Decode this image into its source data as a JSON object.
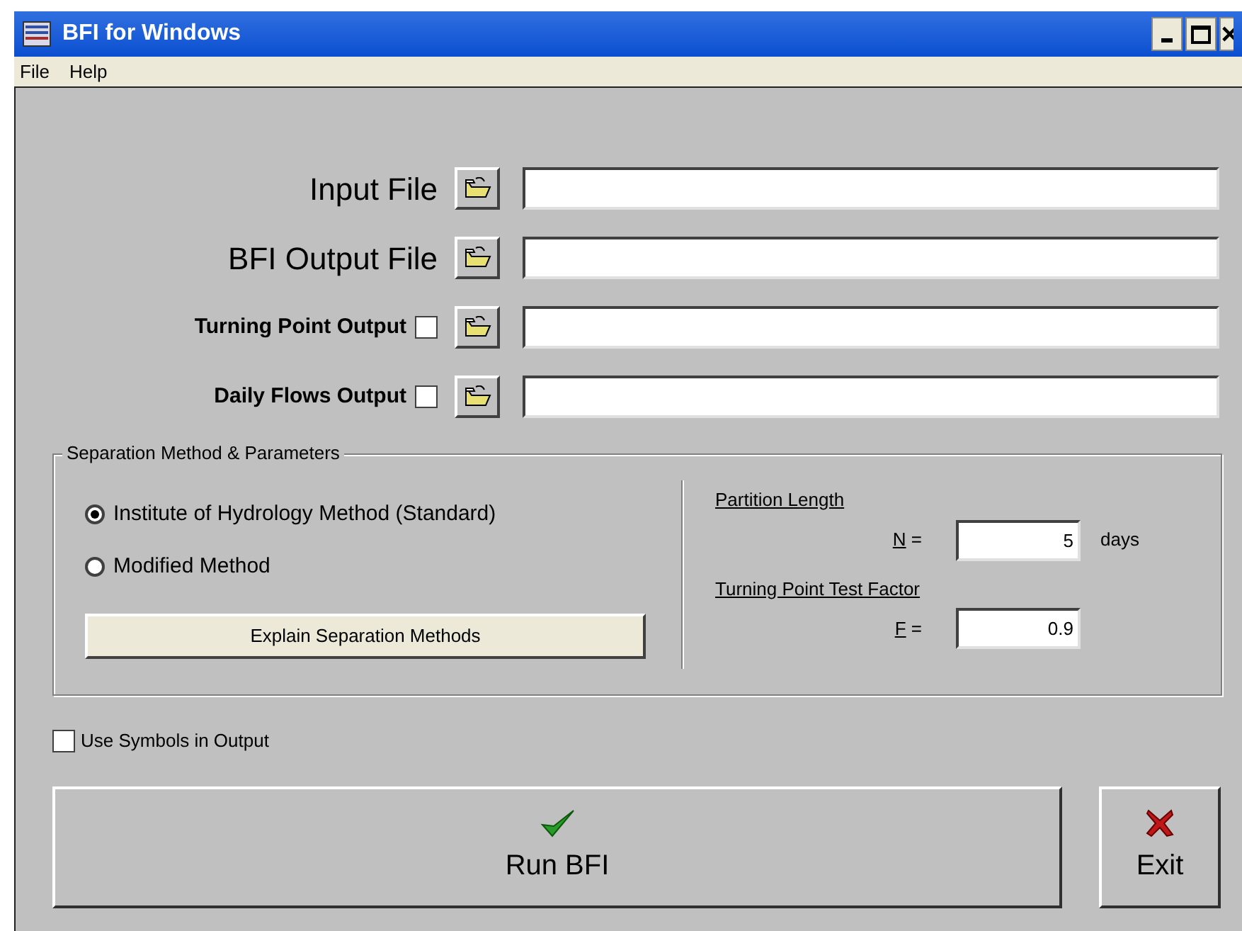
{
  "window": {
    "title": "BFI for Windows"
  },
  "menu": [
    {
      "label": "File"
    },
    {
      "label": "Help"
    }
  ],
  "file_rows": [
    {
      "label": "Input File",
      "kind": "large",
      "value": ""
    },
    {
      "label": "BFI Output File",
      "kind": "large",
      "value": ""
    },
    {
      "label": "Turning Point Output",
      "kind": "checkbox",
      "checked": false,
      "value": ""
    },
    {
      "label": "Daily Flows Output",
      "kind": "checkbox",
      "checked": false,
      "value": ""
    }
  ],
  "separation": {
    "title": "Separation Method & Parameters",
    "methods": [
      {
        "label": "Institute of Hydrology Method (Standard)",
        "selected": true
      },
      {
        "label": "Modified Method",
        "selected": false
      }
    ],
    "explain_button": {
      "label": "Explain Separation Methods"
    },
    "params": [
      {
        "heading": "Partition Length",
        "symbol": "N",
        "eq": "=",
        "value": "5",
        "unit": "days"
      },
      {
        "heading": "Turning Point Test Factor",
        "symbol": "F",
        "eq": "=",
        "value": "0.9"
      }
    ]
  },
  "use_symbols": {
    "label": "Use Symbols in Output",
    "checked": false
  },
  "run_button": {
    "label": "Run BFI"
  },
  "exit_button": {
    "label": "Exit"
  }
}
